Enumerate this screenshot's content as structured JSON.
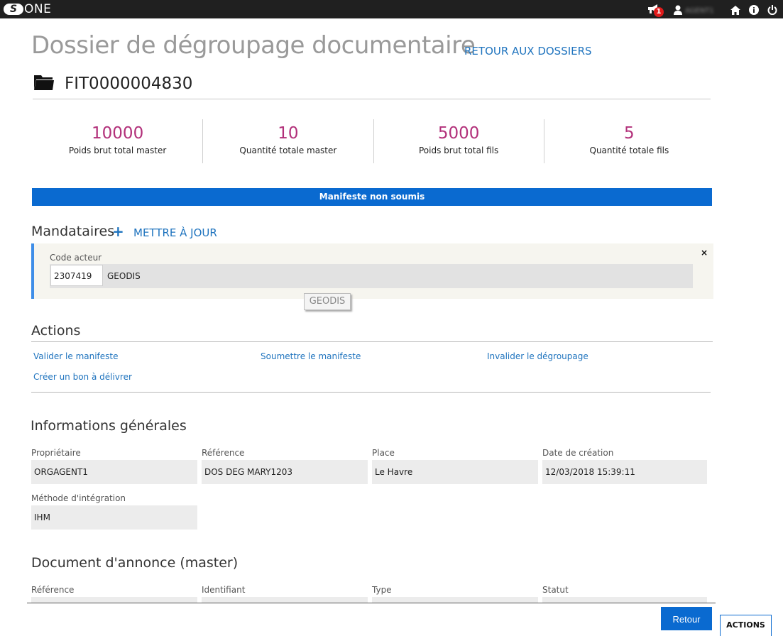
{
  "app": {
    "logo_letter": "S",
    "logo_text": "ONE"
  },
  "topbar": {
    "notification_count": "1",
    "username": "AGENT1"
  },
  "header": {
    "title": "Dossier de dégroupage documentaire",
    "back_link": "RETOUR AUX DOSSIERS",
    "folder_id": "FIT0000004830"
  },
  "stats": [
    {
      "value": "10000",
      "label": "Poids brut total master"
    },
    {
      "value": "10",
      "label": "Quantité totale master"
    },
    {
      "value": "5000",
      "label": "Poids brut total fils"
    },
    {
      "value": "5",
      "label": "Quantité totale fils"
    }
  ],
  "banner": "Manifeste non soumis",
  "mandataires": {
    "title": "Mandataires",
    "add_label": "+",
    "update_label": "METTRE À JOUR",
    "code_label": "Code acteur",
    "code_value": "2307419",
    "code_name": "GEODIS",
    "tooltip": "GEODIS",
    "close_label": "×"
  },
  "actions": {
    "title": "Actions",
    "links": [
      "Valider le manifeste",
      "Soumettre le manifeste",
      "Invalider le dégroupage",
      "Créer un bon à délivrer"
    ]
  },
  "info": {
    "title": "Informations générales",
    "fields": [
      {
        "label": "Propriétaire",
        "value": "ORGAGENT1"
      },
      {
        "label": "Référence",
        "value": "DOS DEG MARY1203"
      },
      {
        "label": "Place",
        "value": "Le Havre"
      },
      {
        "label": "Date de création",
        "value": "12/03/2018 15:39:11"
      },
      {
        "label": "Méthode d'intégration",
        "value": "IHM"
      }
    ]
  },
  "document": {
    "title": "Document d'annonce (master)",
    "columns": [
      "Référence",
      "Identifiant",
      "Type",
      "Statut"
    ]
  },
  "footer": {
    "retour": "Retour",
    "actions": "ACTIONS"
  },
  "colors": {
    "accent": "#0a6ad0",
    "link": "#1e73be",
    "stat": "#b2307a"
  }
}
